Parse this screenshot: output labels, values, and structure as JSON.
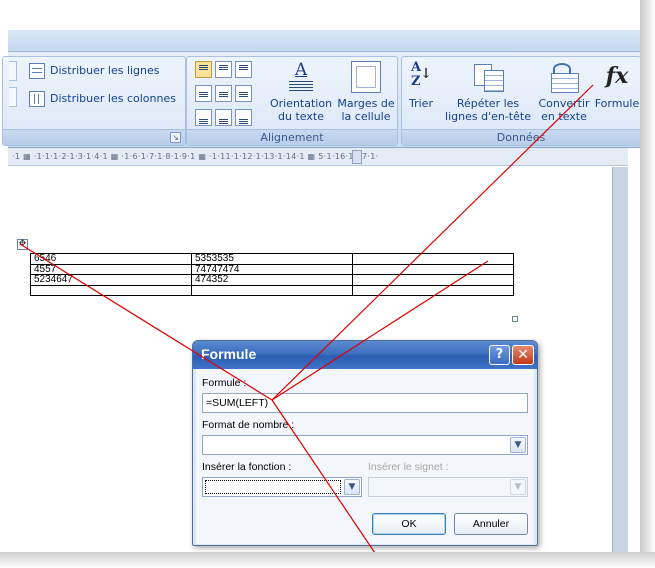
{
  "ribbon": {
    "layout_group": {
      "distribute_rows": "Distribuer les lignes",
      "distribute_cols": "Distribuer les colonnes"
    },
    "alignment_group": {
      "label": "Alignement",
      "text_direction": [
        "Orientation",
        "du texte"
      ],
      "cell_margins": [
        "Marges de",
        "la cellule"
      ]
    },
    "data_group": {
      "label": "Données",
      "sort": "Trier",
      "sort_icon_letters": [
        "A",
        "Z"
      ],
      "repeat_header": [
        "Répéter les",
        "lignes d'en-tête"
      ],
      "convert_text": [
        "Convertir",
        "en texte"
      ],
      "formula": "Formule",
      "formula_icon_text": "fx"
    }
  },
  "ruler": {
    "text": "·1 ▦ ·1·1·1·2·1·3·1·4·1 ▦ ·1·6·1·7·1·8·1·9·1 ▦ ·1·11·1·12·1·13·1·14·1 ▦ 5·1·16·1·17·1·"
  },
  "document": {
    "move_handle_icon": "move-cross-icon",
    "table": [
      [
        "6546",
        "5353535",
        ""
      ],
      [
        "4557",
        "74747474",
        ""
      ],
      [
        "5234647",
        "474352",
        ""
      ],
      [
        "",
        "",
        ""
      ]
    ]
  },
  "dialog": {
    "title": "Formule",
    "help": "?",
    "close": "✕",
    "formula_label": "Formule :",
    "formula_value": "=SUM(LEFT)",
    "number_format_label": "Format de nombre :",
    "number_format_value": "",
    "paste_function_label": "Insérer la fonction :",
    "paste_function_value": "",
    "bookmark_label": "Insérer le signet :",
    "bookmark_value": "",
    "ok": "OK",
    "cancel": "Annuler"
  },
  "colors": {
    "annotation": "#e00000",
    "ribbon_bg": "#d7e4f5",
    "dialog_title": "#3d70c1"
  }
}
